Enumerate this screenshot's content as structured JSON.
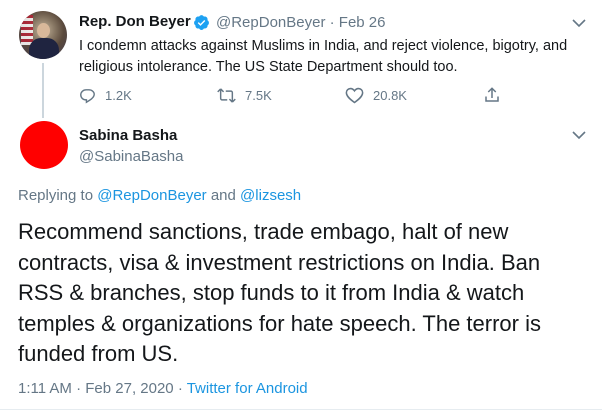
{
  "tweet1": {
    "name": "Rep. Don Beyer",
    "handle_date": "@RepDonBeyer · Feb 26",
    "text": "I condemn attacks against Muslims in India, and reject violence, bigotry, and religious intolerance. The US State Department should too.",
    "actions": {
      "replies": "1.2K",
      "retweets": "7.5K",
      "likes": "20.8K"
    }
  },
  "tweet2": {
    "name": "Sabina Basha",
    "handle": "@SabinaBasha",
    "replying_prefix": "Replying to ",
    "replying_user1": "@RepDonBeyer",
    "replying_and": " and ",
    "replying_user2": "@lizsesh",
    "text": "Recommend sanctions, trade embago, halt of new contracts, visa & investment restrictions  on India. Ban RSS & branches, stop funds to it from India & watch temples & organizations for hate speech. The terror is funded from US.",
    "timestamp": "1:11 AM · Feb 27, 2020 · ",
    "source": "Twitter for Android"
  },
  "colors": {
    "accent": "#1b95e0",
    "avatar2": "#ff0000"
  }
}
